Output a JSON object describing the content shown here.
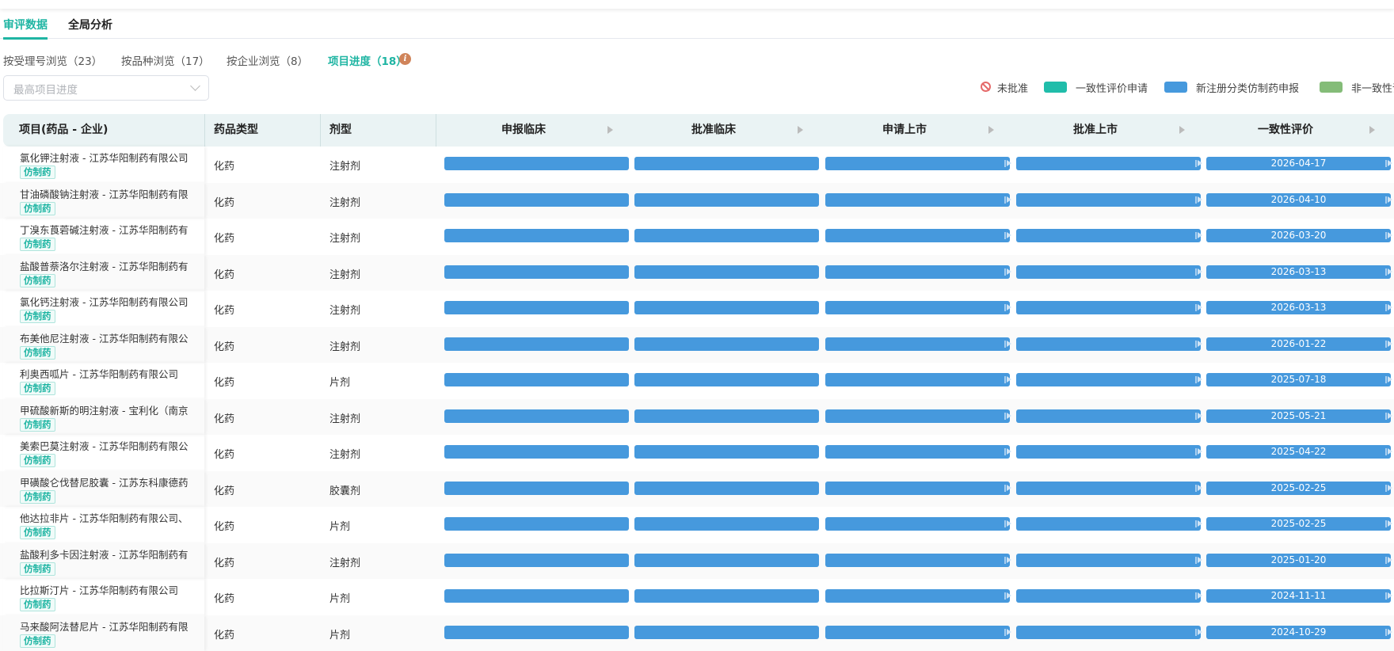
{
  "tabs": [
    {
      "label": "审评数据",
      "active": true
    },
    {
      "label": "全局分析",
      "active": false
    }
  ],
  "subtabs": [
    {
      "label": "按受理号浏览（23）"
    },
    {
      "label": "按品种浏览（17）"
    },
    {
      "label": "按企业浏览（8）"
    },
    {
      "label": "项目进度（18）",
      "active": true
    }
  ],
  "filter": {
    "placeholder": "最高项目进度"
  },
  "legend": [
    {
      "label": "未批准",
      "icon": "no-entry-icon",
      "color": "#e56a6a"
    },
    {
      "label": "一致性评价申请",
      "color": "#20bdaa"
    },
    {
      "label": "新注册分类仿制药申报",
      "color": "#4699dd"
    },
    {
      "label": "非一致性评",
      "color": "#84bc78"
    }
  ],
  "columns": {
    "project": "项目(药品 - 企业)",
    "drug_type": "药品类型",
    "dosage_form": "剂型"
  },
  "stages": [
    "申报临床",
    "批准临床",
    "申请上市",
    "批准上市",
    "一致性评价"
  ],
  "rows": [
    {
      "name": "氯化钾注射液 - 江苏华阳制药有限公司",
      "tag": "仿制药",
      "type": "化药",
      "form": "注射剂",
      "date": "2026-04-17"
    },
    {
      "name": "甘油磷酸钠注射液 - 江苏华阳制药有限",
      "tag": "仿制药",
      "type": "化药",
      "form": "注射剂",
      "date": "2026-04-10"
    },
    {
      "name": "丁溴东莨菪碱注射液 - 江苏华阳制药有",
      "tag": "仿制药",
      "type": "化药",
      "form": "注射剂",
      "date": "2026-03-20"
    },
    {
      "name": "盐酸普萘洛尔注射液 - 江苏华阳制药有",
      "tag": "仿制药",
      "type": "化药",
      "form": "注射剂",
      "date": "2026-03-13"
    },
    {
      "name": "氯化钙注射液 - 江苏华阳制药有限公司",
      "tag": "仿制药",
      "type": "化药",
      "form": "注射剂",
      "date": "2026-03-13"
    },
    {
      "name": "布美他尼注射液 - 江苏华阳制药有限公",
      "tag": "仿制药",
      "type": "化药",
      "form": "注射剂",
      "date": "2026-01-22"
    },
    {
      "name": "利奥西呱片 - 江苏华阳制药有限公司",
      "tag": "仿制药",
      "type": "化药",
      "form": "片剂",
      "date": "2025-07-18"
    },
    {
      "name": "甲硫酸新斯的明注射液 - 宝利化（南京",
      "tag": "仿制药",
      "type": "化药",
      "form": "注射剂",
      "date": "2025-05-21"
    },
    {
      "name": "美索巴莫注射液 - 江苏华阳制药有限公",
      "tag": "仿制药",
      "type": "化药",
      "form": "注射剂",
      "date": "2025-04-22"
    },
    {
      "name": "甲磺酸仑伐替尼胶囊 - 江苏东科康德药",
      "tag": "仿制药",
      "type": "化药",
      "form": "胶囊剂",
      "date": "2025-02-25"
    },
    {
      "name": "他达拉非片 - 江苏华阳制药有限公司、",
      "tag": "仿制药",
      "type": "化药",
      "form": "片剂",
      "date": "2025-02-25"
    },
    {
      "name": "盐酸利多卡因注射液 - 江苏华阳制药有",
      "tag": "仿制药",
      "type": "化药",
      "form": "注射剂",
      "date": "2025-01-20"
    },
    {
      "name": "比拉斯汀片 - 江苏华阳制药有限公司",
      "tag": "仿制药",
      "type": "化药",
      "form": "片剂",
      "date": "2024-11-11"
    },
    {
      "name": "马来酸阿法替尼片 - 江苏华阳制药有限",
      "tag": "仿制药",
      "type": "化药",
      "form": "片剂",
      "date": "2024-10-29"
    }
  ]
}
